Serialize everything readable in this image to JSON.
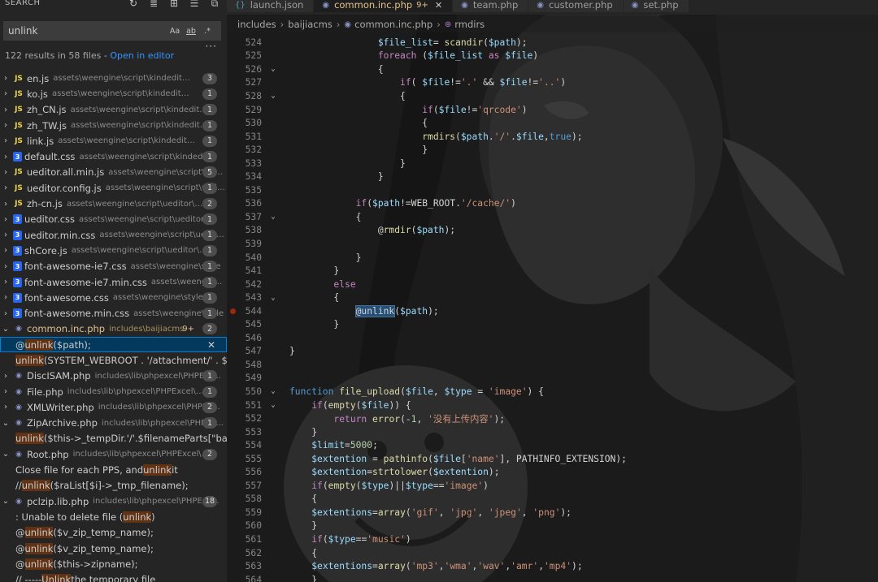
{
  "sidebar": {
    "title": "SEARCH",
    "search_value": "unlink",
    "options": [
      "Aa",
      "ab",
      ".*"
    ],
    "summary_count": "122 results in 58 files - ",
    "summary_link": "Open in editor",
    "results": [
      {
        "kind": "file",
        "icon": "js",
        "name": "en.js",
        "path": "assets\\weengine\\script\\kindeditor\\lang",
        "count": "3"
      },
      {
        "kind": "file",
        "icon": "js",
        "name": "ko.js",
        "path": "assets\\weengine\\script\\kindeditor\\lang",
        "count": "1"
      },
      {
        "kind": "file",
        "icon": "js",
        "name": "zh_CN.js",
        "path": "assets\\weengine\\script\\kindeditor\\la...",
        "count": "1"
      },
      {
        "kind": "file",
        "icon": "js",
        "name": "zh_TW.js",
        "path": "assets\\weengine\\script\\kindeditor\\l...",
        "count": "1"
      },
      {
        "kind": "file",
        "icon": "js",
        "name": "link.js",
        "path": "assets\\weengine\\script\\kindeditor\\plug...",
        "count": "1"
      },
      {
        "kind": "file",
        "icon": "css",
        "name": "default.css",
        "path": "assets\\weengine\\script\\kindeditor...",
        "count": "1"
      },
      {
        "kind": "file",
        "icon": "js",
        "name": "ueditor.all.min.js",
        "path": "assets\\weengine\\script\\ued...",
        "count": "5"
      },
      {
        "kind": "file",
        "icon": "js",
        "name": "ueditor.config.js",
        "path": "assets\\weengine\\script\\uedi...",
        "count": "1"
      },
      {
        "kind": "file",
        "icon": "js",
        "name": "zh-cn.js",
        "path": "assets\\weengine\\script\\ueditor\\lang\\...",
        "count": "2"
      },
      {
        "kind": "file",
        "icon": "css",
        "name": "ueditor.css",
        "path": "assets\\weengine\\script\\ueditor\\th...",
        "count": "1"
      },
      {
        "kind": "file",
        "icon": "css",
        "name": "ueditor.min.css",
        "path": "assets\\weengine\\script\\uedit...",
        "count": "1"
      },
      {
        "kind": "file",
        "icon": "css",
        "name": "shCore.js",
        "path": "assets\\weengine\\script\\ueditor\\thir...",
        "count": "1"
      },
      {
        "kind": "file",
        "icon": "css",
        "name": "font-awesome-ie7.css",
        "path": "assets\\weengine\\style",
        "count": "1"
      },
      {
        "kind": "file",
        "icon": "css",
        "name": "font-awesome-ie7.min.css",
        "path": "assets\\weengine...",
        "count": "1"
      },
      {
        "kind": "file",
        "icon": "css",
        "name": "font-awesome.css",
        "path": "assets\\weengine\\style",
        "count": "1"
      },
      {
        "kind": "file",
        "icon": "css",
        "name": "font-awesome.min.css",
        "path": "assets\\weengine\\style",
        "count": "1"
      },
      {
        "kind": "file",
        "icon": "php",
        "name": "common.inc.php",
        "path": "includes\\baijiacms",
        "count": "2",
        "modified": "9+",
        "open": true
      },
      {
        "kind": "match",
        "pre": "@",
        "hl": "unlink",
        "post": "($path);",
        "selected": true
      },
      {
        "kind": "match",
        "pre": "",
        "hl": "unlink",
        "post": "(SYSTEM_WEBROOT . '/attachment/' . $file_r..."
      },
      {
        "kind": "file",
        "icon": "php",
        "name": "DiscISAM.php",
        "path": "includes\\lib\\phpexcel\\PHPExc...",
        "count": "1"
      },
      {
        "kind": "file",
        "icon": "php",
        "name": "File.php",
        "path": "includes\\lib\\phpexcel\\PHPExcel\\Shar...",
        "count": "1"
      },
      {
        "kind": "file",
        "icon": "php",
        "name": "XMLWriter.php",
        "path": "includes\\lib\\phpexcel\\PHPEx...",
        "count": "2"
      },
      {
        "kind": "file",
        "icon": "php",
        "name": "ZipArchive.php",
        "path": "includes\\lib\\phpexcel\\PHPEx...",
        "count": "1",
        "open": true
      },
      {
        "kind": "match",
        "pre": "",
        "hl": "unlink",
        "post": "($this->_tempDir.'/'.$filenameParts[\"basena..."
      },
      {
        "kind": "file",
        "icon": "php",
        "name": "Root.php",
        "path": "includes\\lib\\phpexcel\\PHPExcel\\Sh...",
        "count": "2",
        "open": true
      },
      {
        "kind": "match",
        "pre": "Close file for each PPS, and ",
        "hl": "unlink",
        "post": " it"
      },
      {
        "kind": "match",
        "pre": "//     ",
        "hl": "unlink",
        "post": "($raList[$i]->_tmp_filename);"
      },
      {
        "kind": "file",
        "icon": "php",
        "name": "pclzip.lib.php",
        "path": "includes\\lib\\phpexcel\\PHPExc...",
        "count": "18",
        "open": true
      },
      {
        "kind": "match",
        "pre": ": Unable to delete file (",
        "hl": "unlink",
        "post": ")"
      },
      {
        "kind": "match",
        "pre": "@",
        "hl": "unlink",
        "post": "($v_zip_temp_name);"
      },
      {
        "kind": "match",
        "pre": "@",
        "hl": "unlink",
        "post": "($v_zip_temp_name);"
      },
      {
        "kind": "match",
        "pre": "@",
        "hl": "unlink",
        "post": "($this->zipname);"
      },
      {
        "kind": "match",
        "pre": "// ----- ",
        "hl": "Unlink",
        "post": " the temporary file"
      }
    ]
  },
  "tabs": [
    {
      "label": "launch.json",
      "icon": "{}"
    },
    {
      "label": "common.inc.php",
      "icon": "php",
      "active": true,
      "modified": "9+"
    },
    {
      "label": "team.php",
      "icon": "php"
    },
    {
      "label": "customer.php",
      "icon": "php"
    },
    {
      "label": "set.php",
      "icon": "php"
    }
  ],
  "breadcrumb": [
    "includes",
    "baijiacms",
    "common.inc.php",
    "rmdirs"
  ],
  "code_lines": [
    {
      "n": "524",
      "t": "                $file_list= scandir($path);"
    },
    {
      "n": "525",
      "t": "                foreach ($file_list as $file)"
    },
    {
      "n": "526",
      "t": "                {",
      "fold": true
    },
    {
      "n": "527",
      "t": "                    if( $file!='.' && $file!='..')"
    },
    {
      "n": "528",
      "t": "                    {",
      "fold": true
    },
    {
      "n": "529",
      "t": "                        if($file!='qrcode')"
    },
    {
      "n": "530",
      "t": "                        {"
    },
    {
      "n": "531",
      "t": "                        rmdirs($path.'/'.$file,true);"
    },
    {
      "n": "532",
      "t": "                        }"
    },
    {
      "n": "533",
      "t": "                    }"
    },
    {
      "n": "534",
      "t": "                }"
    },
    {
      "n": "535",
      "t": ""
    },
    {
      "n": "536",
      "t": "            if($path!=WEB_ROOT.'/cache/')"
    },
    {
      "n": "537",
      "t": "            {",
      "fold": true
    },
    {
      "n": "538",
      "t": "                @rmdir($path);"
    },
    {
      "n": "539",
      "t": ""
    },
    {
      "n": "540",
      "t": "            }"
    },
    {
      "n": "541",
      "t": "        }"
    },
    {
      "n": "542",
      "t": "        else"
    },
    {
      "n": "543",
      "t": "        {",
      "fold": true
    },
    {
      "n": "544",
      "t": "            @unlink($path);",
      "bp": true
    },
    {
      "n": "545",
      "t": "        }"
    },
    {
      "n": "546",
      "t": ""
    },
    {
      "n": "547",
      "t": "}"
    },
    {
      "n": "548",
      "t": ""
    },
    {
      "n": "549",
      "t": ""
    },
    {
      "n": "550",
      "t": "function file_upload($file, $type = 'image') {",
      "fold": true
    },
    {
      "n": "551",
      "t": "    if(empty($file)) {",
      "fold": true
    },
    {
      "n": "552",
      "t": "        return error(-1, '没有上传内容');"
    },
    {
      "n": "553",
      "t": "    }"
    },
    {
      "n": "554",
      "t": "    $limit=5000;"
    },
    {
      "n": "555",
      "t": "    $extention = pathinfo($file['name'], PATHINFO_EXTENSION);"
    },
    {
      "n": "556",
      "t": "    $extention=strtolower($extention);"
    },
    {
      "n": "557",
      "t": "    if(empty($type)||$type=='image')"
    },
    {
      "n": "558",
      "t": "    {"
    },
    {
      "n": "559",
      "t": "    $extentions=array('gif', 'jpg', 'jpeg', 'png');"
    },
    {
      "n": "560",
      "t": "    }"
    },
    {
      "n": "561",
      "t": "    if($type=='music')"
    },
    {
      "n": "562",
      "t": "    {"
    },
    {
      "n": "563",
      "t": "    $extentions=array('mp3','wma','wav','amr','mp4');"
    },
    {
      "n": "564",
      "t": "    }"
    }
  ],
  "colors": {
    "accent": "#007fd4",
    "modified": "#e2c08d",
    "match_highlight": "#613214"
  }
}
